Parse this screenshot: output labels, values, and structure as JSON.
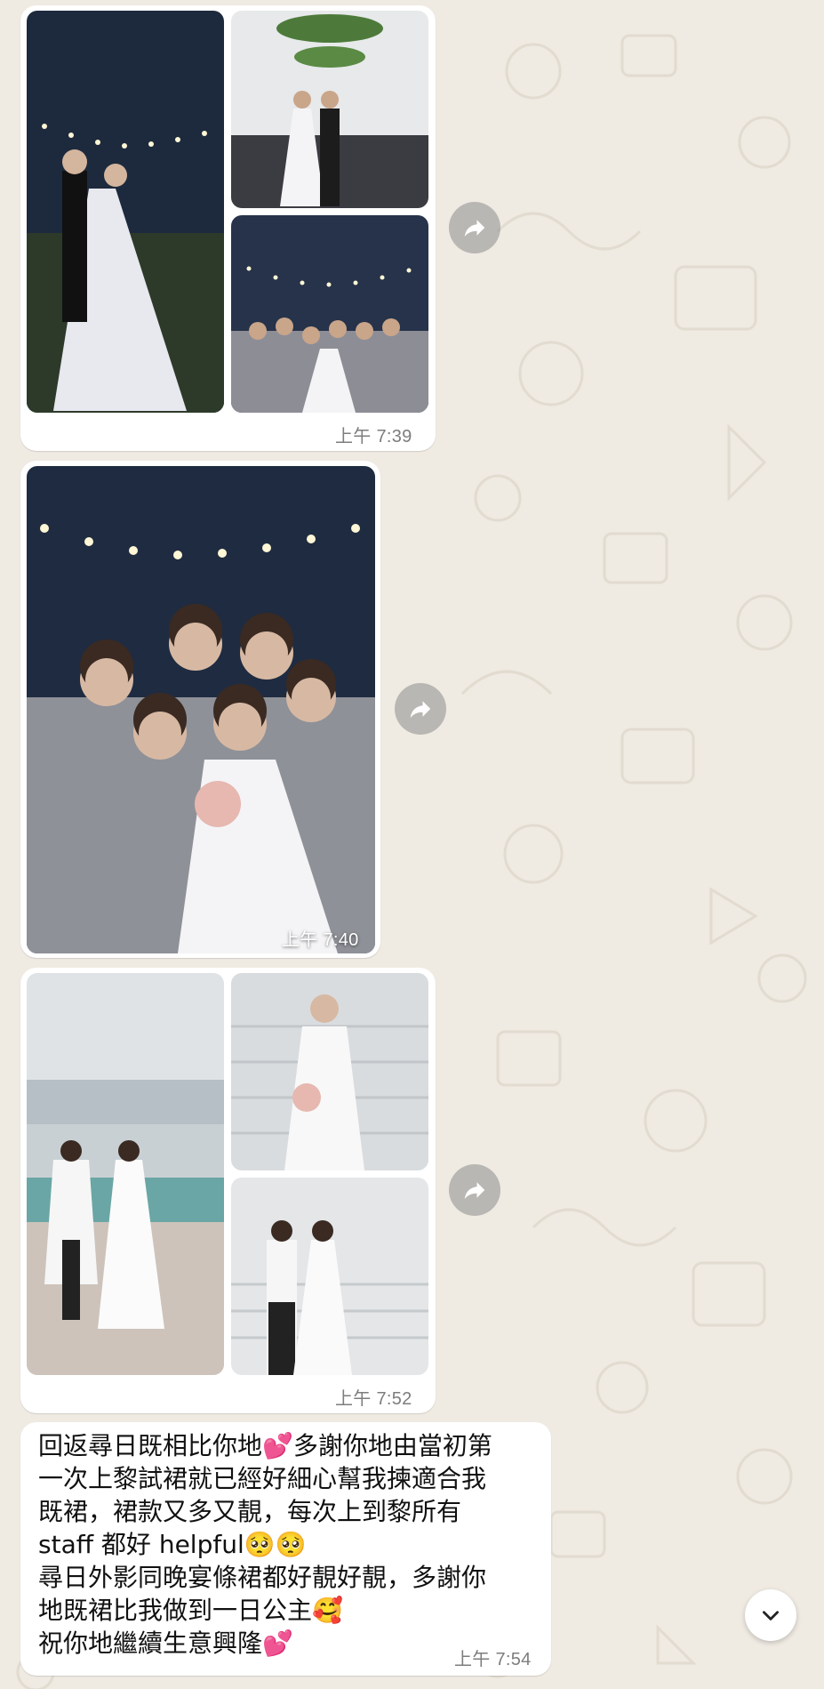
{
  "messages": [
    {
      "time": "上午 7:39"
    },
    {
      "time": "上午 7:40"
    },
    {
      "time": "上午 7:52"
    },
    {
      "lines": [
        "回返尋日既相比你地💕多謝你地由當初第",
        "一次上黎試裙就已經好細心幫我揀適合我",
        "既裙，裙款又多又靚，每次上到黎所有",
        "staff 都好 helpful🥺🥺",
        "尋日外影同晚宴條裙都好靚好靚，多謝你",
        "地既裙比我做到一日公主🥰",
        "祝你地繼續生意興隆💕"
      ],
      "time": "上午 7:54"
    }
  ],
  "icons": {
    "forward": "forward-arrow-icon",
    "scroll_down": "chevron-down-icon"
  },
  "colors": {
    "chat_background": "#efeae2",
    "bubble": "#ffffff",
    "timestamp": "#7d7d7d"
  }
}
